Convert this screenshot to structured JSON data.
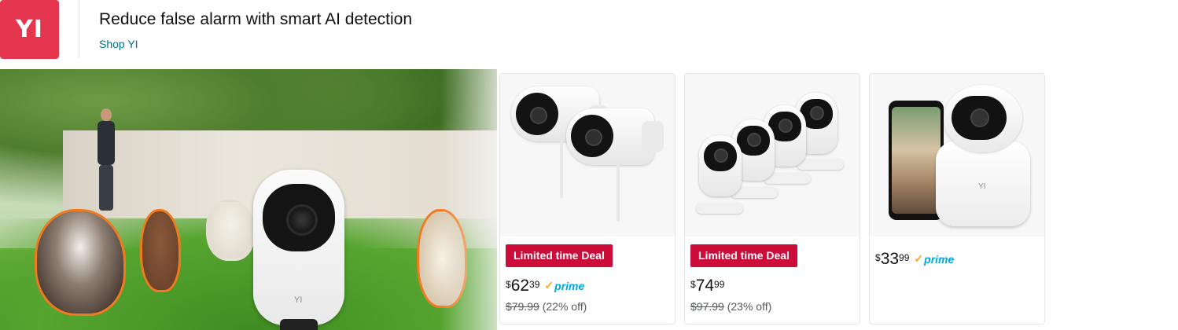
{
  "brand": {
    "logo_text": "YI",
    "headline": "Reduce false alarm with smart AI detection",
    "shop_link": "Shop YI",
    "logo_color": "#e4364f"
  },
  "hero": {
    "camera_mark": "YI"
  },
  "products": [
    {
      "badge": "Limited time Deal",
      "price_symbol": "$",
      "price_whole": "62",
      "price_fraction": "39",
      "prime": true,
      "prime_label": "prime",
      "was_price": "$79.99",
      "discount": "(22% off)",
      "image_icon": "outdoor-bullet-cameras"
    },
    {
      "badge": "Limited time Deal",
      "price_symbol": "$",
      "price_whole": "74",
      "price_fraction": "99",
      "prime": false,
      "was_price": "$97.99",
      "discount": "(23% off)",
      "image_icon": "indoor-cameras-4pack"
    },
    {
      "price_symbol": "$",
      "price_whole": "33",
      "price_fraction": "99",
      "prime": true,
      "prime_label": "prime",
      "image_icon": "pan-tilt-camera-with-phone",
      "product_mark": "YI"
    }
  ],
  "colors": {
    "deal_badge": "#cc0c39",
    "link": "#007185",
    "prime": "#00a8e1",
    "prime_check": "#ffa41c"
  }
}
